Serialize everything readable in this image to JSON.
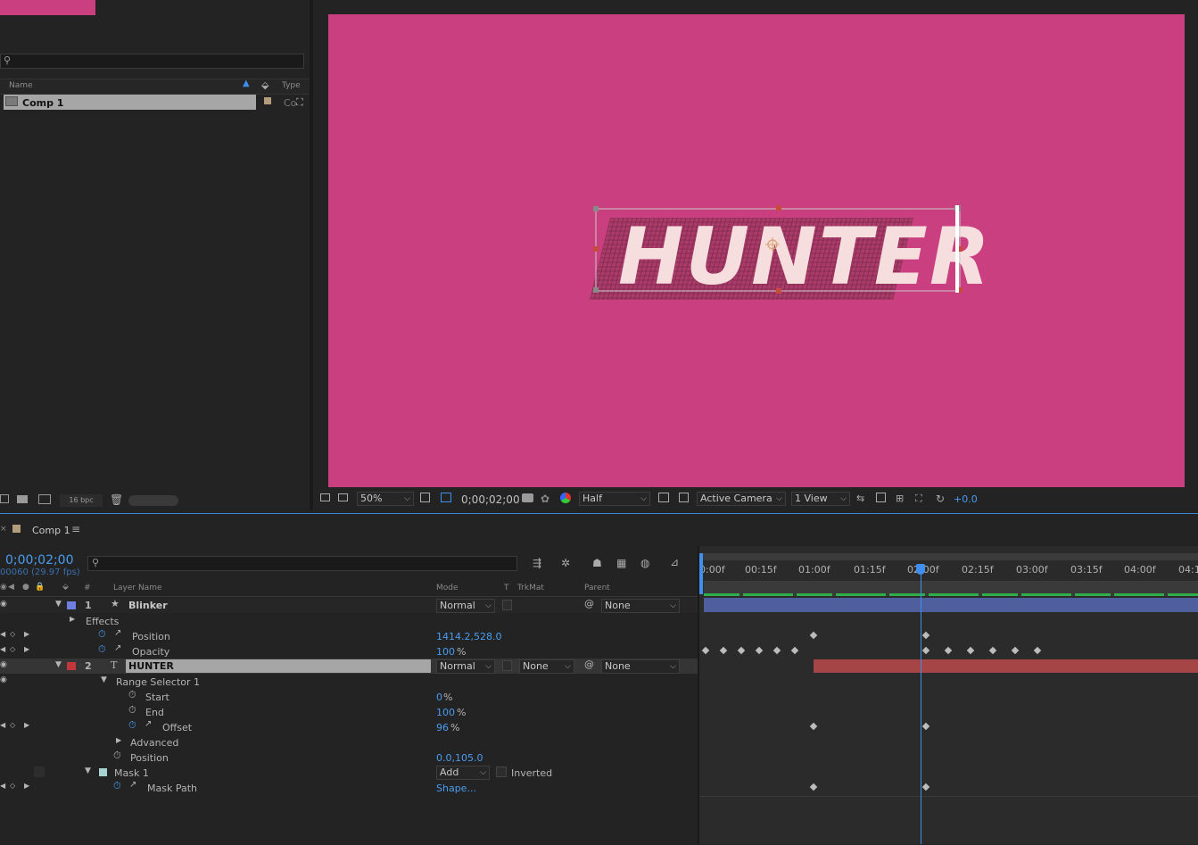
{
  "project": {
    "columns": {
      "name": "Name",
      "type": "Type"
    },
    "items": [
      {
        "name": "Comp 1",
        "type": "Co"
      }
    ],
    "footer": {
      "bpc": "16 bpc"
    }
  },
  "viewer": {
    "comp_text": "HUNTER",
    "zoom": "50%",
    "timecode": "0;00;02;00",
    "resolution": "Half",
    "camera": "Active Camera",
    "views": "1 View",
    "exposure": "+0.0"
  },
  "timeline": {
    "tab_title": "Comp 1",
    "current_time": "0;00;02;00",
    "frame_info": "00060 (29.97 fps)",
    "headers": {
      "num": "#",
      "layer_name": "Layer Name",
      "mode": "Mode",
      "t": "T",
      "trkmat": "TrkMat",
      "parent": "Parent"
    },
    "ruler": [
      "0:00f",
      "00:15f",
      "01:00f",
      "01:15f",
      "02:00f",
      "02:15f",
      "03:00f",
      "03:15f",
      "04:00f",
      "04:1"
    ],
    "rows": [
      {
        "type": "layer",
        "num": "1",
        "name": "Blinker",
        "mode": "Normal",
        "parent": "None",
        "color": "#6f7fe0"
      },
      {
        "type": "group",
        "name": "Effects"
      },
      {
        "type": "prop",
        "name": "Position",
        "value": "1414.2,528.0"
      },
      {
        "type": "prop",
        "name": "Opacity",
        "value": "100",
        "unit": "%"
      },
      {
        "type": "layer",
        "num": "2",
        "name": "HUNTER",
        "mode": "Normal",
        "trkmat": "None",
        "parent": "None",
        "color": "#c0373d"
      },
      {
        "type": "group",
        "name": "Range Selector 1"
      },
      {
        "type": "prop",
        "name": "Start",
        "value": "0",
        "unit": "%"
      },
      {
        "type": "prop",
        "name": "End",
        "value": "100",
        "unit": "%"
      },
      {
        "type": "prop",
        "name": "Offset",
        "value": "96",
        "unit": "%"
      },
      {
        "type": "group",
        "name": "Advanced"
      },
      {
        "type": "prop",
        "name": "Position",
        "value": "0.0,105.0"
      },
      {
        "type": "mask",
        "name": "Mask 1",
        "mode": "Add",
        "inverted": "Inverted"
      },
      {
        "type": "prop",
        "name": "Mask Path",
        "value": "Shape..."
      }
    ]
  },
  "colors": {
    "canvas": "#c93f80",
    "accent": "#3f8ff0",
    "layer1_bar": "#4f5f9e",
    "layer2_bar": "#a54545"
  }
}
